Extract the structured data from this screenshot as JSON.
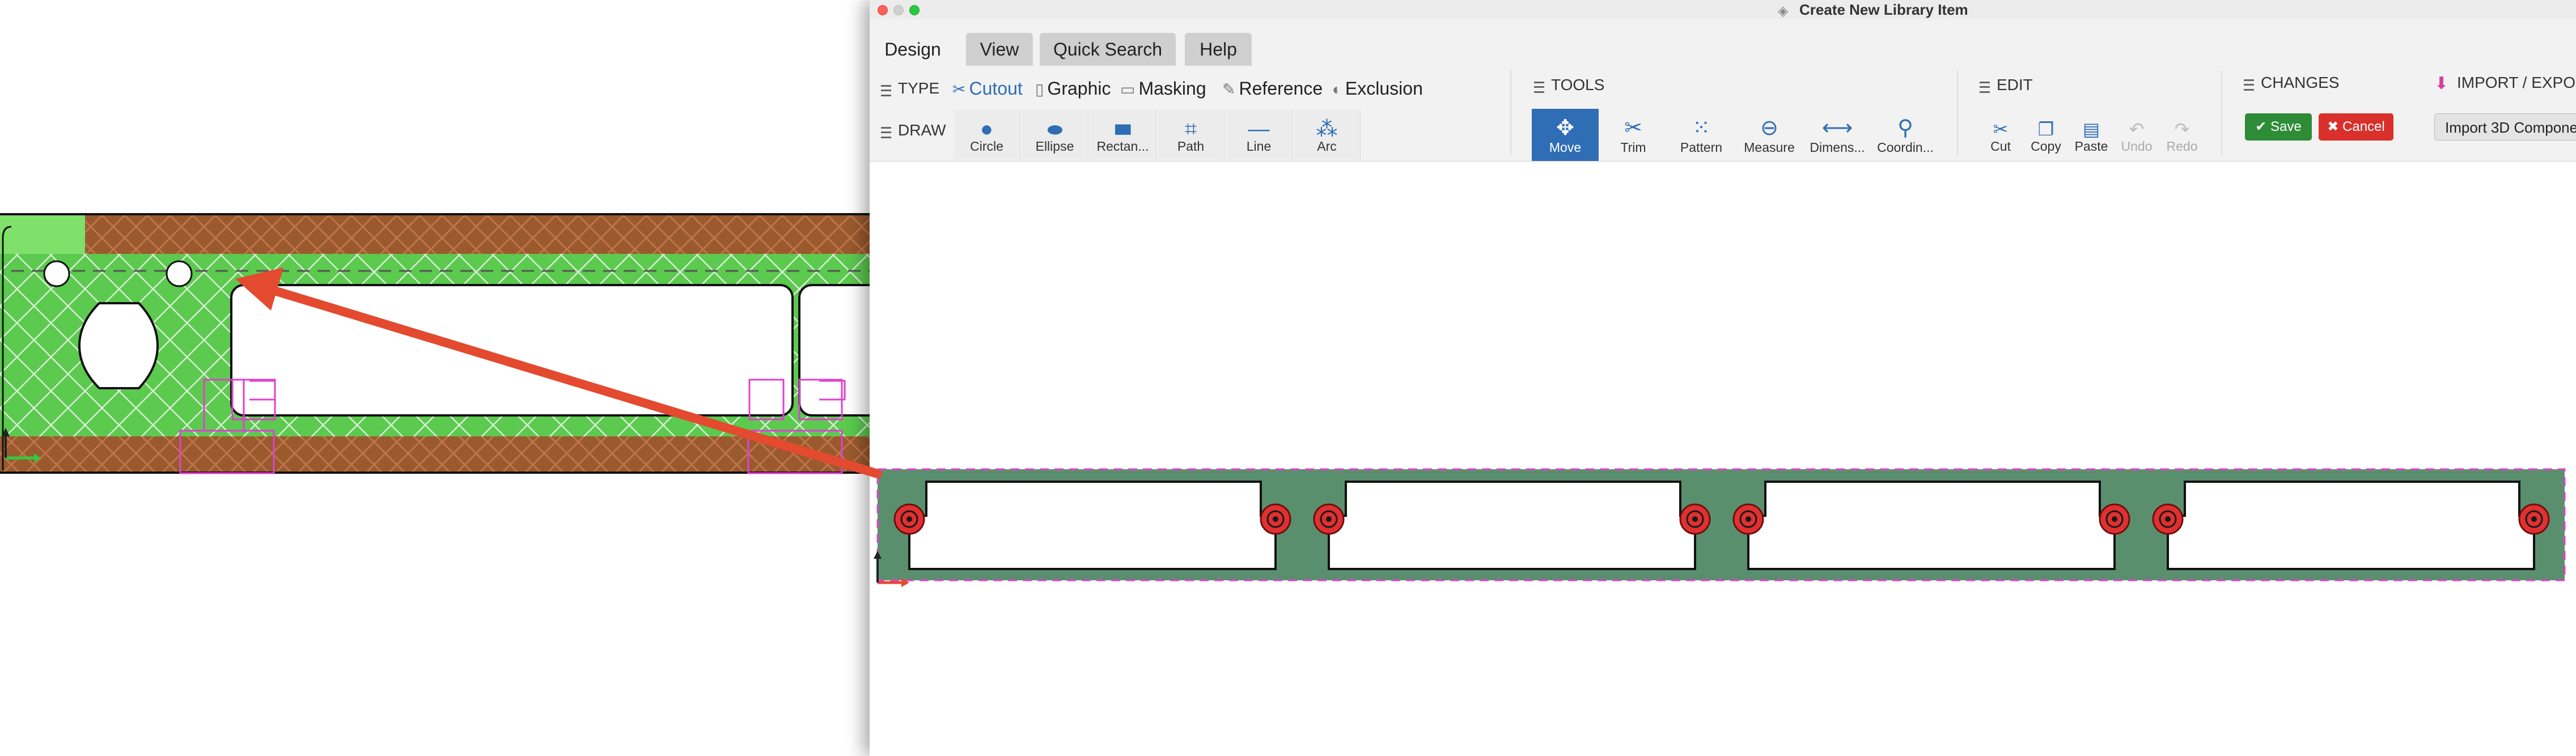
{
  "window": {
    "title": "Create New Library Item"
  },
  "menu_tabs": [
    {
      "label": "Design",
      "active": true
    },
    {
      "label": "View",
      "active": false
    },
    {
      "label": "Quick Search",
      "active": false
    },
    {
      "label": "Help",
      "active": false
    }
  ],
  "type_row": {
    "label": "TYPE",
    "items": [
      {
        "label": "Cutout",
        "icon": "scissors-icon",
        "active": true
      },
      {
        "label": "Graphic",
        "icon": "document-icon",
        "active": false
      },
      {
        "label": "Masking",
        "icon": "masking-tape-icon",
        "active": false
      },
      {
        "label": "Reference",
        "icon": "pencil-icon",
        "active": false
      },
      {
        "label": "Exclusion",
        "icon": "half-circle-icon",
        "active": false
      }
    ]
  },
  "draw_row": {
    "label": "DRAW",
    "buttons": [
      {
        "label": "Circle",
        "icon": "circle-icon"
      },
      {
        "label": "Ellipse",
        "icon": "ellipse-icon"
      },
      {
        "label": "Rectan...",
        "icon": "rectangle-icon"
      },
      {
        "label": "Path",
        "icon": "path-icon"
      },
      {
        "label": "Line",
        "icon": "line-icon"
      },
      {
        "label": "Arc",
        "icon": "arc-icon"
      }
    ]
  },
  "tools": {
    "label": "TOOLS",
    "buttons": [
      {
        "label": "Move",
        "icon": "move-icon",
        "selected": true
      },
      {
        "label": "Trim",
        "icon": "trim-icon",
        "selected": false
      },
      {
        "label": "Pattern",
        "icon": "pattern-icon",
        "selected": false
      },
      {
        "label": "Measure",
        "icon": "measure-icon",
        "selected": false
      },
      {
        "label": "Dimens...",
        "icon": "dimension-icon",
        "selected": false
      },
      {
        "label": "Coordin...",
        "icon": "location-pin-icon",
        "selected": false
      }
    ]
  },
  "edit": {
    "label": "EDIT",
    "buttons": [
      {
        "label": "Cut",
        "icon": "scissors-icon",
        "enabled": true
      },
      {
        "label": "Copy",
        "icon": "copy-icon",
        "enabled": true
      },
      {
        "label": "Paste",
        "icon": "paste-icon",
        "enabled": true
      },
      {
        "label": "Undo",
        "icon": "undo-icon",
        "enabled": false
      },
      {
        "label": "Redo",
        "icon": "redo-icon",
        "enabled": false
      }
    ]
  },
  "changes": {
    "label": "CHANGES",
    "save_label": "Save",
    "cancel_label": "Cancel"
  },
  "import_export": {
    "label": "IMPORT / EXPO",
    "button_label": "Import 3D Componen"
  },
  "colors": {
    "accent": "#2f6db5",
    "save": "#2e8b36",
    "cancel": "#d9302b",
    "panel_fill": "#5a8f6e",
    "background_board_green": "#5cc94f",
    "background_board_brown": "#9a5a2e",
    "arrow": "#e34a2f",
    "selection_magenta": "#e040d0",
    "hole_marker": "#e03030"
  }
}
